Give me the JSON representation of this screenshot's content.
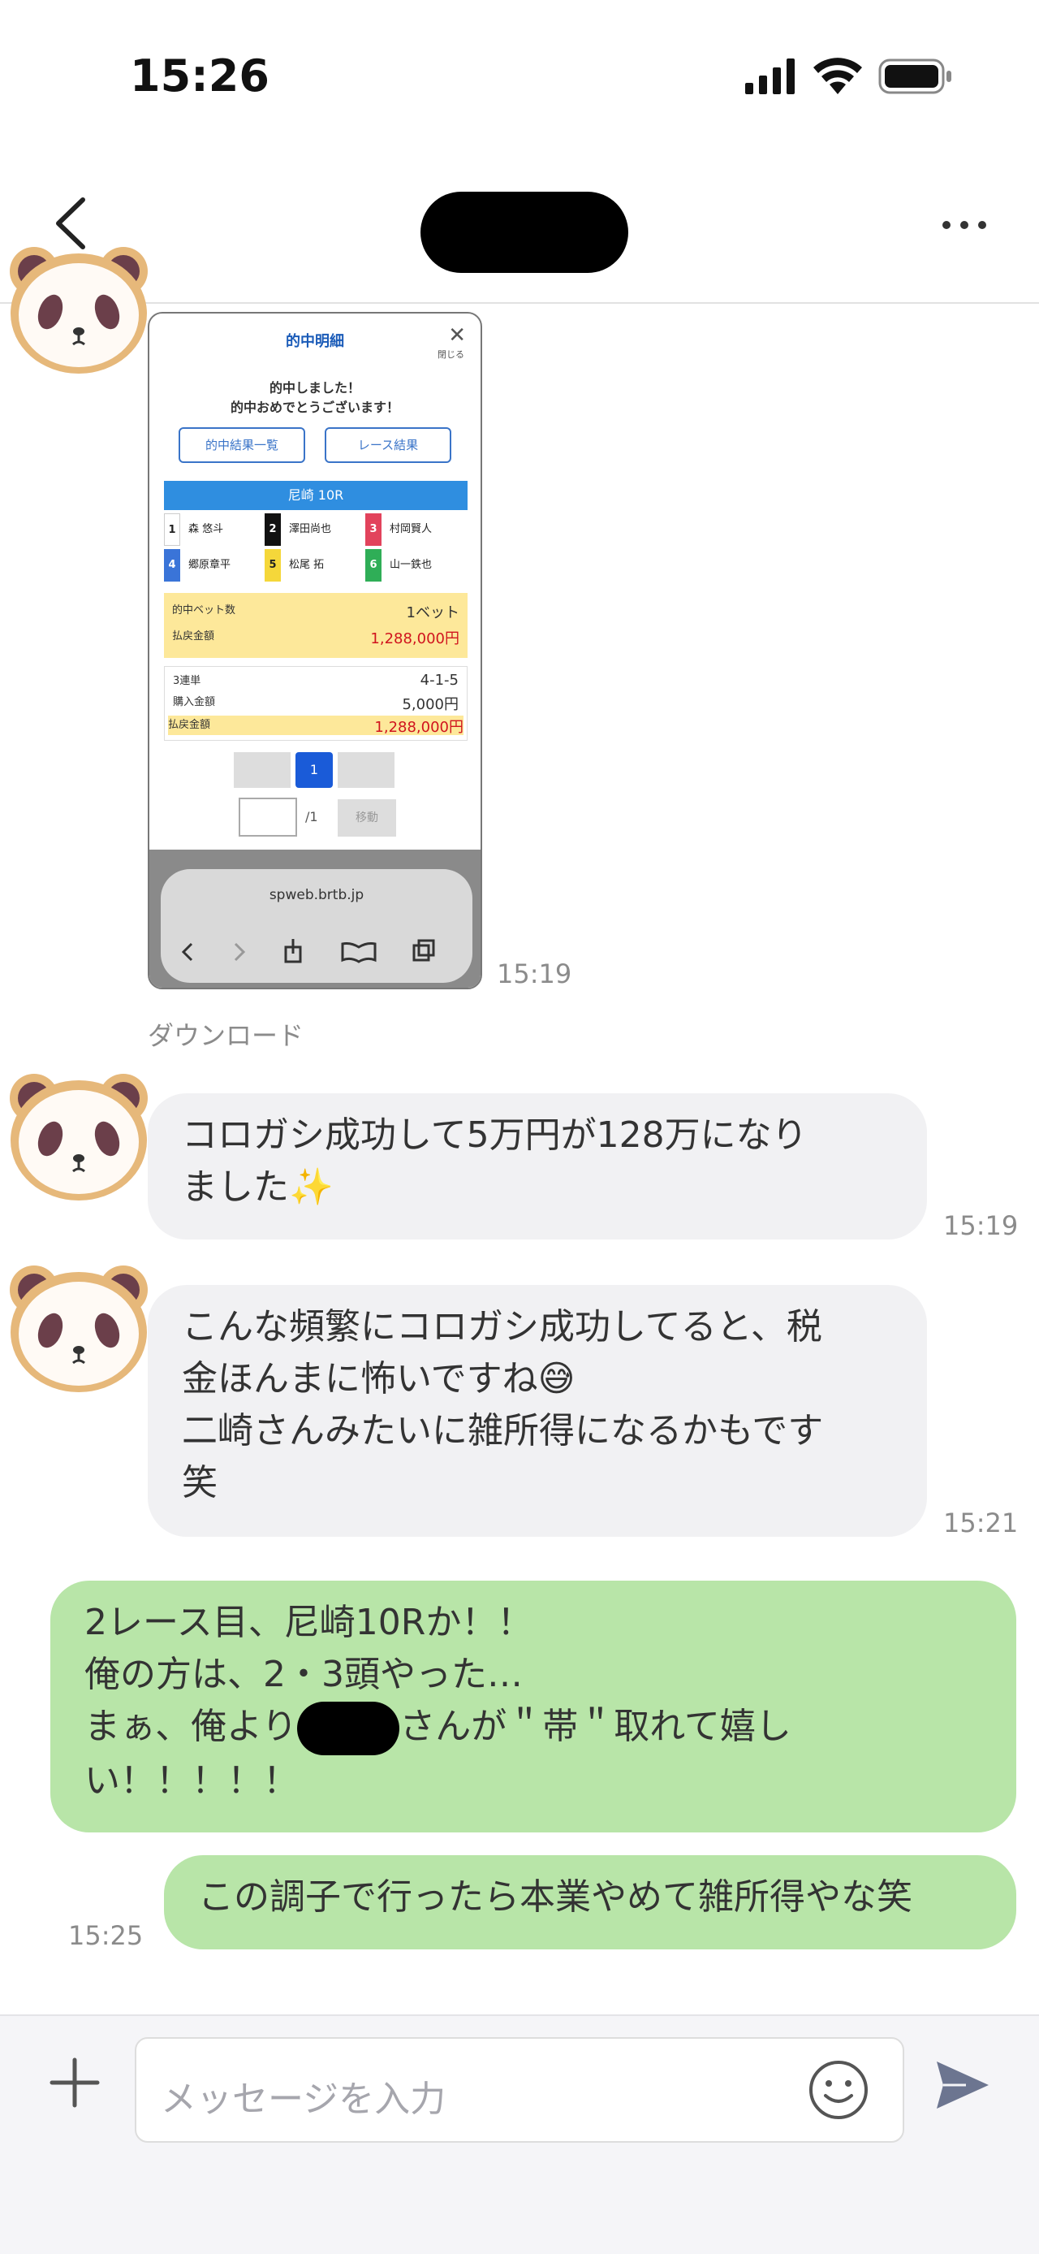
{
  "status": {
    "time": "15:26"
  },
  "messages": [
    {
      "image": {
        "title": "的中明細",
        "close_label": "✕",
        "close_sub": "閉じる",
        "hit_line1": "的中しました！",
        "hit_line2": "的中おめでとうございます！",
        "btn_list": "的中結果一覧",
        "btn_result": "レース結果",
        "race": "尼崎 10R",
        "horses": [
          {
            "no": "1",
            "name": "森 悠斗",
            "color": "#ffffff",
            "fg": "#222"
          },
          {
            "no": "2",
            "name": "澤田尚也",
            "color": "#111111",
            "fg": "#fff"
          },
          {
            "no": "3",
            "name": "村岡賢人",
            "color": "#e2435c",
            "fg": "#fff"
          },
          {
            "no": "4",
            "name": "郷原章平",
            "color": "#3a74d8",
            "fg": "#fff"
          },
          {
            "no": "5",
            "name": "松尾 拓",
            "color": "#f5d73a",
            "fg": "#222"
          },
          {
            "no": "6",
            "name": "山一鉄也",
            "color": "#2fae57",
            "fg": "#fff"
          }
        ],
        "bet_count_label": "的中ベット数",
        "bet_count_value": "1ベット",
        "payout_label": "払戻金額",
        "payout_value": "1,288,000円",
        "type_label": "3連単",
        "type_value": "4-1-5",
        "buy_label": "購入金額",
        "buy_value": "5,000円",
        "payout2_label": "払戻金額",
        "payout2_value": "1,288,000円",
        "page": "1",
        "page_total": "/1",
        "page_go": "移動",
        "url": "spweb.brtb.jp"
      },
      "time": "15:19"
    },
    {
      "download": "ダウンロード"
    },
    {
      "text_line1": "コロガシ成功して5万円が128万になり",
      "text_line2": "ました✨",
      "time": "15:19"
    },
    {
      "text_line1": "こんな頻繁にコロガシ成功してると、税",
      "text_line2": "金ほんまに怖いですね😅",
      "text_line3": "二崎さんみたいに雑所得になるかもです",
      "text_line4": "笑",
      "time": "15:21"
    },
    {
      "text_line1": "2レース目、尼崎10Rか！！",
      "text_line2": "俺の方は、2・3頭やった…",
      "text_line3a": "まぁ、俺より",
      "text_line3b": "さんが＂帯＂取れて嬉し",
      "text_line4": "い！！！！！"
    },
    {
      "text": "この調子で行ったら本業やめて雑所得やな笑",
      "time": "15:25"
    }
  ],
  "composer": {
    "placeholder": "メッセージを入力"
  },
  "colors": {
    "incoming": "#f1f1f3",
    "outgoing": "#b8e5a8",
    "accent": "#1a5bb8"
  }
}
